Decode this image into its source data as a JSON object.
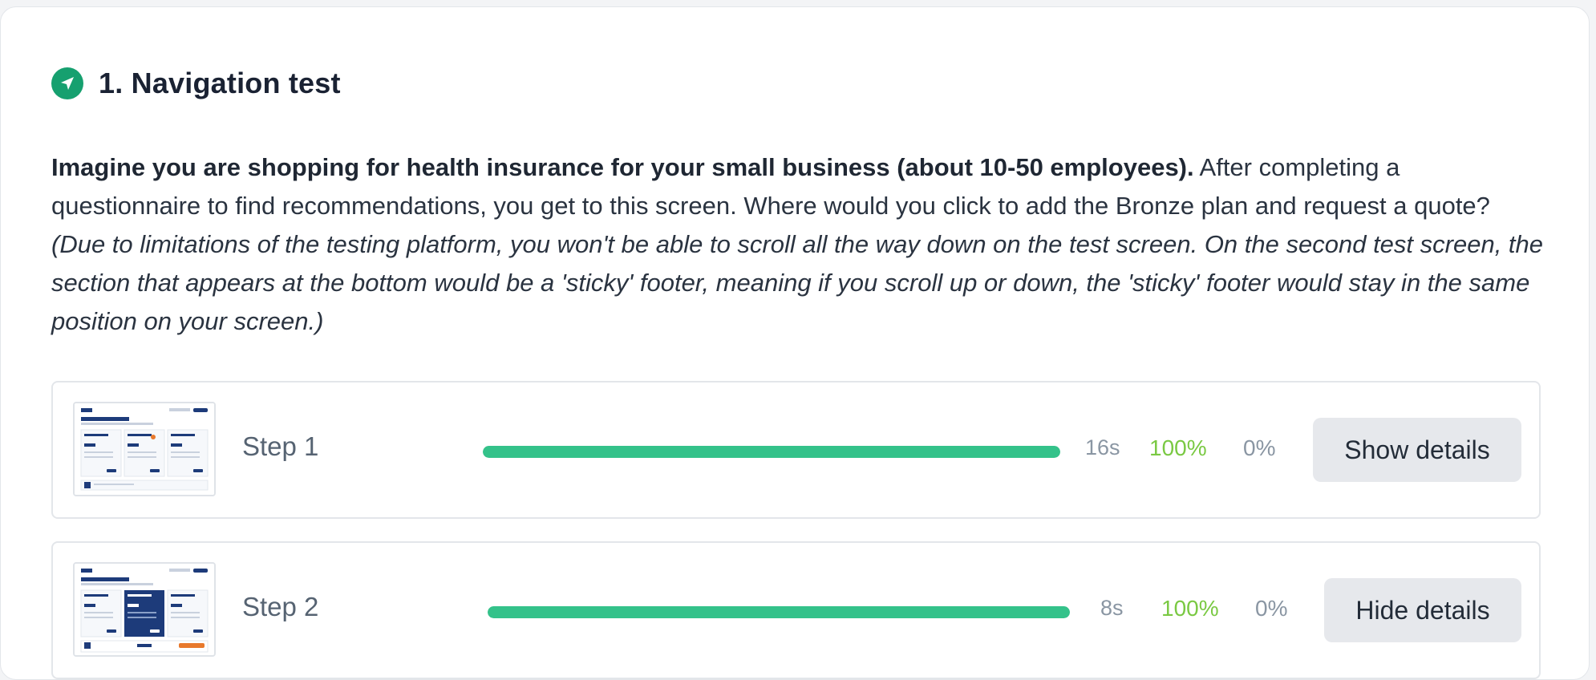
{
  "section": {
    "title": "1. Navigation test",
    "icon": "navigation-arrow-icon",
    "accent_color": "#16a06f"
  },
  "description": {
    "bold": "Imagine you are shopping for health insurance for your small business (about 10-50 employees).",
    "regular": " After completing a questionnaire to find recommendations, you get to this screen. Where would you click to add the Bronze plan and request a quote? ",
    "italic": "(Due to limitations of the testing platform, you won't be able to scroll all the way down on the test screen. On the second test screen, the section that appears at the bottom would be a 'sticky' footer, meaning if you scroll up or down, the 'sticky' footer would stay in the same position on your screen.)"
  },
  "steps": [
    {
      "label": "Step 1",
      "time": "16s",
      "success": "100%",
      "fail": "0%",
      "progress": 1.0,
      "button_label": "Show details"
    },
    {
      "label": "Step 2",
      "time": "8s",
      "success": "100%",
      "fail": "0%",
      "progress": 1.0,
      "button_label": "Hide details"
    }
  ],
  "colors": {
    "progress": "#34c28a",
    "success_text": "#7ac943",
    "muted_text": "#8a96a3"
  }
}
